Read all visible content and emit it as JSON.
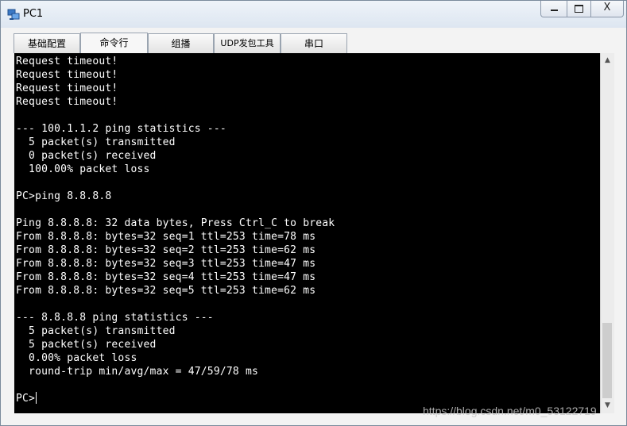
{
  "window": {
    "title": "PC1",
    "minimize_label": "",
    "maximize_label": "",
    "close_label": "X"
  },
  "tabs": [
    {
      "label": "基础配置",
      "active": false
    },
    {
      "label": "命令行",
      "active": true
    },
    {
      "label": "组播",
      "active": false
    },
    {
      "label": "UDP发包工具",
      "active": false
    },
    {
      "label": "串口",
      "active": false
    }
  ],
  "terminal": {
    "lines": [
      "Request timeout!",
      "Request timeout!",
      "Request timeout!",
      "Request timeout!",
      "",
      "--- 100.1.1.2 ping statistics ---",
      "  5 packet(s) transmitted",
      "  0 packet(s) received",
      "  100.00% packet loss",
      "",
      "PC>ping 8.8.8.8",
      "",
      "Ping 8.8.8.8: 32 data bytes, Press Ctrl_C to break",
      "From 8.8.8.8: bytes=32 seq=1 ttl=253 time=78 ms",
      "From 8.8.8.8: bytes=32 seq=2 ttl=253 time=62 ms",
      "From 8.8.8.8: bytes=32 seq=3 ttl=253 time=47 ms",
      "From 8.8.8.8: bytes=32 seq=4 ttl=253 time=47 ms",
      "From 8.8.8.8: bytes=32 seq=5 ttl=253 time=62 ms",
      "",
      "--- 8.8.8.8 ping statistics ---",
      "  5 packet(s) transmitted",
      "  5 packet(s) received",
      "  0.00% packet loss",
      "  round-trip min/avg/max = 47/59/78 ms",
      "",
      "PC>"
    ],
    "background": "#000000",
    "foreground": "#ffffff"
  },
  "watermark": "https://blog.csdn.net/m0_53122719"
}
